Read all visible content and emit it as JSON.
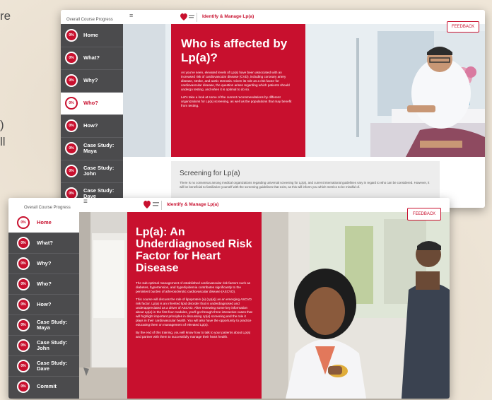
{
  "background": {
    "text_fragments": [
      "re",
      ")",
      "ll"
    ]
  },
  "back_screen": {
    "header": {
      "progress_label": "Overall Course Progress",
      "menu_icon": "hamburger-menu-icon",
      "logo_icon": "aha-heart-logo-icon",
      "course_title": "Identify & Manage Lp(a)",
      "feedback_label": "FEEDBACK"
    },
    "nav": [
      {
        "pct": "0%",
        "label": "Home",
        "active": false
      },
      {
        "pct": "0%",
        "label": "What?",
        "active": false
      },
      {
        "pct": "0%",
        "label": "Why?",
        "active": false
      },
      {
        "pct": "0%",
        "label": "Who?",
        "active": true
      },
      {
        "pct": "0%",
        "label": "How?",
        "active": false
      },
      {
        "pct": "0%",
        "label": "Case Study:\nMaya",
        "active": false
      },
      {
        "pct": "0%",
        "label": "Case Study:\nJohn",
        "active": false
      },
      {
        "pct": "0%",
        "label": "Case Study:\nDave",
        "active": false
      }
    ],
    "panel": {
      "title": "Who is affected by Lp(a)?",
      "para1": "As you've seen, elevated levels of Lp(a) have been associated with an increased risk of cardiovascular disease (CVD), including coronary artery disease, stroke, and aortic stenosis. Given its role as a risk factor for cardiovascular disease, the question arises regarding which patients should undergo testing, and when it is optimal to do so.",
      "para2": "Let's take a look at some of the current recommendations by different organizations for Lp(a) screening, as well as the populations that may benefit from testing."
    },
    "screening": {
      "title": "Screening for Lp(a)",
      "body": "There is no consensus among medical organizations regarding universal screening for Lp(a), and current international guidelines vary in regard to who can be considered. However, it will be beneficial to familiarize yourself with the screening guidelines that exist, as this will inform you which metrics to be mindful of."
    }
  },
  "front_screen": {
    "header": {
      "progress_label": "Overall Course Progress",
      "menu_icon": "hamburger-menu-icon",
      "logo_icon": "aha-heart-logo-icon",
      "course_title": "Identify & Manage Lp(a)",
      "feedback_label": "FEEDBACK"
    },
    "nav": [
      {
        "pct": "0%",
        "label": "Home",
        "active": true
      },
      {
        "pct": "0%",
        "label": "What?",
        "active": false
      },
      {
        "pct": "0%",
        "label": "Why?",
        "active": false
      },
      {
        "pct": "0%",
        "label": "Who?",
        "active": false
      },
      {
        "pct": "0%",
        "label": "How?",
        "active": false
      },
      {
        "pct": "0%",
        "label": "Case Study:\nMaya",
        "active": false
      },
      {
        "pct": "0%",
        "label": "Case Study:\nJohn",
        "active": false
      },
      {
        "pct": "0%",
        "label": "Case Study:\nDave",
        "active": false
      },
      {
        "pct": "0%",
        "label": "Commit",
        "active": false
      }
    ],
    "panel": {
      "title": "Lp(a): An Underdiagnosed Risk Factor for Heart Disease",
      "para1": "The sub-optimal management of established cardiovascular risk factors such as diabetes, hypertension, and hyperlipidemia contributes significantly to the persistent burden of atherosclerotic cardiovascular disease (ASCVD).",
      "para2": "This course will discuss the role of lipoprotein (a) (Lp(a)) as an emerging ASCVD risk factor. Lp(a) is an inherited lipid disorder that is underdiagnosed and underappreciated as a driver of ASCVD. After reviewing some key information about Lp(a) in the first four modules, you'll go through three interactive cases that will highlight important principles in discussing Lp(a) screening and the role it plays in their cardiovascular health. You will also have the opportunity to practice educating them on management of elevated Lp(a).",
      "para3": "By the end of this training, you will know how to talk to your patients about Lp(a) and partner with them to successfully manage their heart health."
    }
  }
}
